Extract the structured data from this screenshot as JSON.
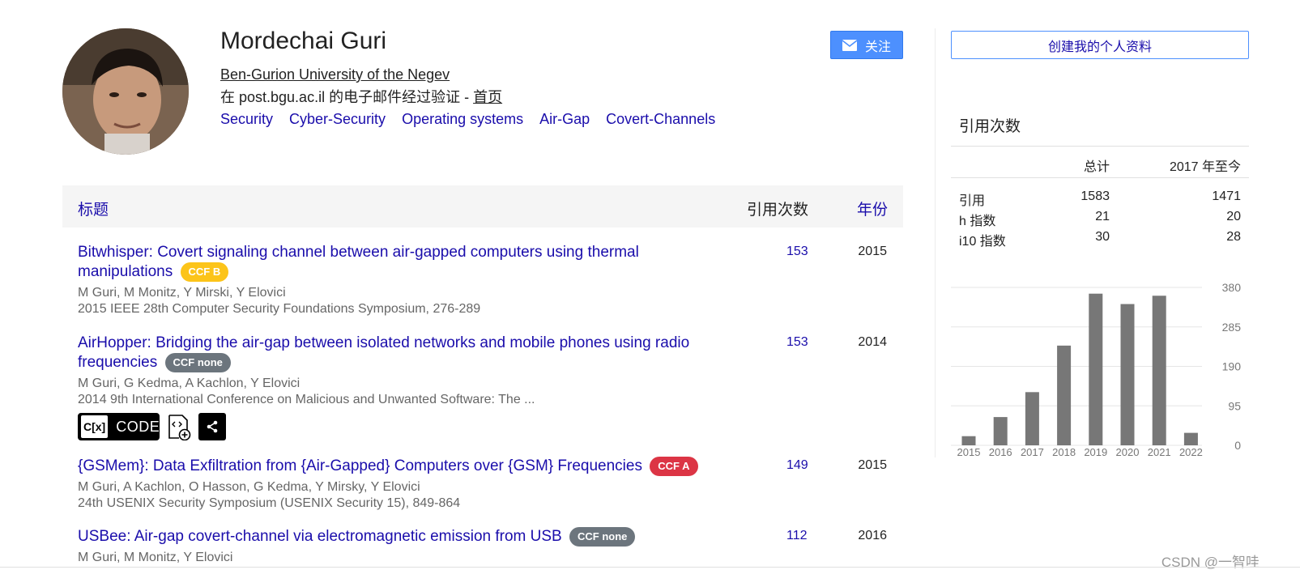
{
  "profile": {
    "name": "Mordechai Guri",
    "affiliation": "Ben-Gurion University of the Negev",
    "verified_prefix": "在 post.bgu.ac.il 的电子邮件经过验证 - ",
    "homepage_label": "首页",
    "interests": [
      "Security",
      "Cyber-Security",
      "Operating systems",
      "Air-Gap",
      "Covert-Channels"
    ],
    "follow_label": "关注",
    "create_profile_label": "创建我的个人资料"
  },
  "table": {
    "col_title": "标题",
    "col_cited": "引用次数",
    "col_year": "年份",
    "rows": [
      {
        "title": "Bitwhisper: Covert signaling channel between air-gapped computers using thermal manipulations",
        "badge": "CCF B",
        "authors": "M Guri, M Monitz, Y Mirski, Y Elovici",
        "venue": "2015 IEEE 28th Computer Security Foundations Symposium, 276-289",
        "cited": "153",
        "year": "2015"
      },
      {
        "title": "AirHopper: Bridging the air-gap between isolated networks and mobile phones using radio frequencies",
        "badge": "CCF none",
        "authors": "M Guri, G Kedma, A Kachlon, Y Elovici",
        "venue": "2014 9th International Conference on Malicious and Unwanted Software: The ...",
        "cited": "153",
        "year": "2014",
        "code_label": "CODE",
        "code_logo": "C[x]"
      },
      {
        "title": "{GSMem}: Data Exfiltration from {Air-Gapped} Computers over {GSM} Frequencies",
        "badge": "CCF A",
        "authors": "M Guri, A Kachlon, O Hasson, G Kedma, Y Mirsky, Y Elovici",
        "venue": "24th USENIX Security Symposium (USENIX Security 15), 849-864",
        "cited": "149",
        "year": "2015"
      },
      {
        "title": "USBee: Air-gap covert-channel via electromagnetic emission from USB",
        "badge": "CCF none",
        "authors": "M Guri, M Monitz, Y Elovici",
        "venue": "",
        "cited": "112",
        "year": "2016"
      }
    ]
  },
  "citations": {
    "title": "引用次数",
    "col_total": "总计",
    "col_since": "2017 年至今",
    "rows": [
      {
        "label": "引用",
        "total": "1583",
        "since": "1471"
      },
      {
        "label": "h 指数",
        "total": "21",
        "since": "20"
      },
      {
        "label": "i10 指数",
        "total": "30",
        "since": "28"
      }
    ]
  },
  "chart_data": {
    "type": "bar",
    "categories": [
      "2015",
      "2016",
      "2017",
      "2018",
      "2019",
      "2020",
      "2021",
      "2022"
    ],
    "values": [
      22,
      68,
      128,
      240,
      365,
      340,
      360,
      30
    ],
    "ylim": [
      0,
      380
    ],
    "yticks": [
      "380",
      "285",
      "190",
      "95",
      "0"
    ],
    "grid": true,
    "bar_color": "#777777"
  },
  "colors": {
    "link": "#1a0dab",
    "follow": "#4d90fe",
    "ccf_b": "#fcc419",
    "ccf_none": "#6c757d",
    "ccf_a": "#dc3545"
  },
  "watermark": "CSDN @一智哇"
}
